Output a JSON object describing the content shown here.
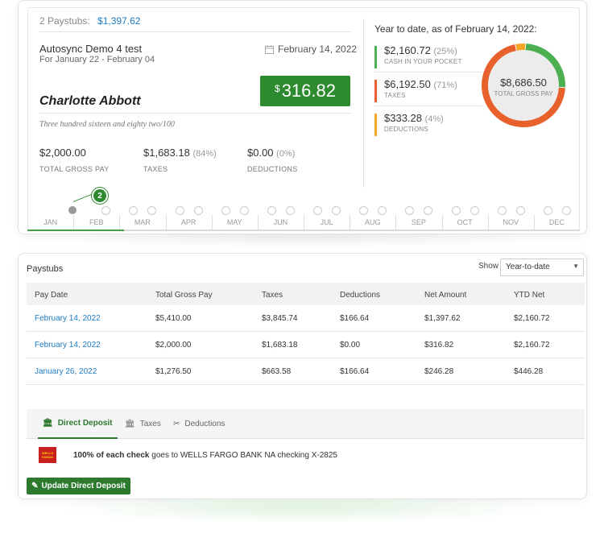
{
  "top": {
    "paystub_count": "2 Paystubs:",
    "paystub_total": "$1,397.62",
    "company": "Autosync Demo 4 test",
    "period": "For January 22 - February 04",
    "pay_date": "February 14, 2022",
    "employee": "Charlotte Abbott",
    "net_pay": {
      "currency": "$",
      "amount": "316.82"
    },
    "amount_words": "Three hundred sixteen and eighty two/100",
    "summary": [
      {
        "value": "$2,000.00",
        "pct": "",
        "label": "TOTAL GROSS PAY"
      },
      {
        "value": "$1,683.18",
        "pct": "(84%)",
        "label": "TAXES"
      },
      {
        "value": "$0.00",
        "pct": "(0%)",
        "label": "DEDUCTIONS"
      }
    ]
  },
  "ytd": {
    "title": "Year to date, as of February 14, 2022:",
    "items": [
      {
        "value": "$2,160.72",
        "pct": "(25%)",
        "label": "CASH IN YOUR POCKET",
        "color": "#4caf50"
      },
      {
        "value": "$6,192.50",
        "pct": "(71%)",
        "label": "TAXES",
        "color": "#e8602c"
      },
      {
        "value": "$333.28",
        "pct": "(4%)",
        "label": "DEDUCTIONS",
        "color": "#f5a623"
      }
    ],
    "donut": {
      "total": "$8,686.50",
      "label": "TOTAL GROSS PAY",
      "fractions": [
        0.25,
        0.71,
        0.04
      ]
    }
  },
  "timeline": {
    "months": [
      "JAN",
      "FEB",
      "MAR",
      "APR",
      "MAY",
      "JUN",
      "JUL",
      "AUG",
      "SEP",
      "OCT",
      "NOV",
      "DEC"
    ],
    "badge": "2"
  },
  "paystubs": {
    "title": "Paystubs",
    "show_label": "Show",
    "filter_value": "Year-to-date",
    "headers": [
      "Pay Date",
      "Total Gross Pay",
      "Taxes",
      "Deductions",
      "Net Amount",
      "YTD Net"
    ],
    "rows": [
      [
        "February 14, 2022",
        "$5,410.00",
        "$3,845.74",
        "$166.64",
        "$1,397.62",
        "$2,160.72"
      ],
      [
        "February 14, 2022",
        "$2,000.00",
        "$1,683.18",
        "$0.00",
        "$316.82",
        "$2,160.72"
      ],
      [
        "January 26, 2022",
        "$1,276.50",
        "$663.58",
        "$166.64",
        "$246.28",
        "$446.28"
      ]
    ],
    "tabs": [
      {
        "label": "Direct Deposit",
        "icon": "bank-icon"
      },
      {
        "label": "Taxes",
        "icon": "bank-icon"
      },
      {
        "label": "Deductions",
        "icon": "split-icon"
      }
    ],
    "deposit_bold": "100% of each check",
    "deposit_text": "goes to WELLS FARGO BANK NA checking X-2825",
    "bank_logo": [
      "WELLS",
      "FARGO"
    ],
    "update_button": "Update Direct Deposit"
  },
  "colors": {
    "accent": "#2d7a2f",
    "link": "#1e7bc2"
  }
}
